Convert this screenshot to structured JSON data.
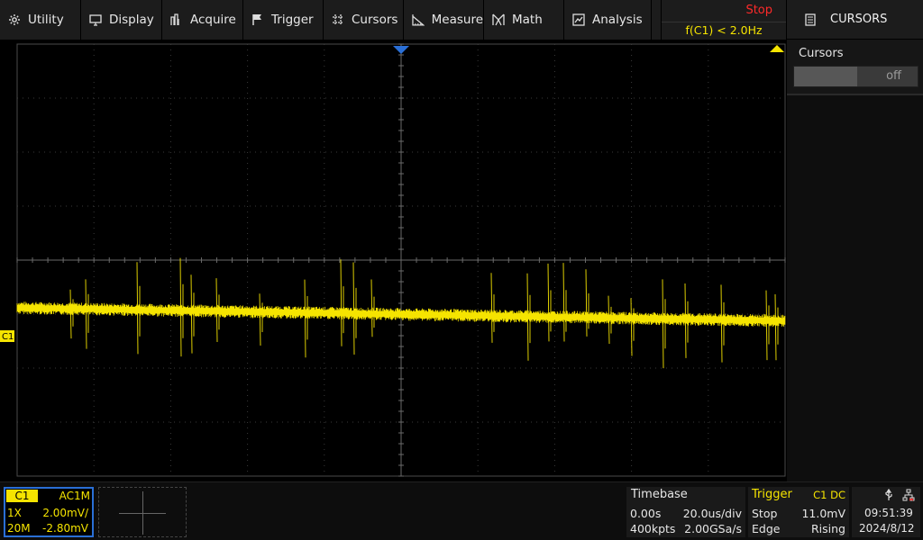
{
  "menu": [
    {
      "label": "Utility",
      "icon": "gear-icon"
    },
    {
      "label": "Display",
      "icon": "monitor-icon"
    },
    {
      "label": "Acquire",
      "icon": "acquire-icon"
    },
    {
      "label": "Trigger",
      "icon": "flag-icon"
    },
    {
      "label": "Cursors",
      "icon": "cursor-grid-icon"
    },
    {
      "label": "Measure",
      "icon": "measure-icon"
    },
    {
      "label": "Math",
      "icon": "math-icon"
    },
    {
      "label": "Analysis",
      "icon": "analysis-icon"
    }
  ],
  "status": {
    "run_state": "Stop",
    "frequency": "f(C1) < 2.0Hz"
  },
  "side_panel": {
    "title": "CURSORS",
    "cursors_label": "Cursors",
    "cursors_state": "off"
  },
  "channel": {
    "marker": "C1",
    "tag": "C1",
    "coupling": "AC1M",
    "probe": "1X",
    "scale": "2.00mV/",
    "bandwidth": "20M",
    "offset": "-2.80mV",
    "color": "#f5e400"
  },
  "timebase": {
    "title": "Timebase",
    "delay": "0.00s",
    "scale": "20.0us/div",
    "memory": "400kpts",
    "sample_rate": "2.00GSa/s"
  },
  "trigger": {
    "title": "Trigger",
    "source": "C1 DC",
    "state": "Stop",
    "level": "11.0mV",
    "type": "Edge",
    "slope": "Rising"
  },
  "system": {
    "time": "09:51:39",
    "date": "2024/8/12"
  },
  "colors": {
    "trace": "#f5e400",
    "accent": "#2a6fd6",
    "stop": "#ff2a2a",
    "trigger_marker": "#2a6fd6"
  }
}
